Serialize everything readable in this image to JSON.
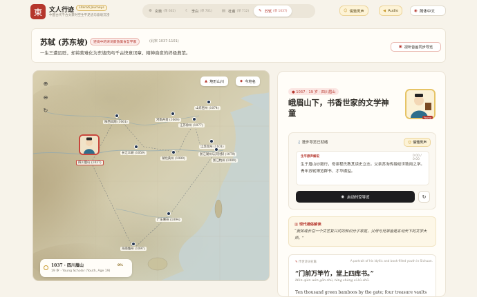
{
  "brand": {
    "logo_char": "東",
    "title": "文人行迹",
    "tag": "Literati Journeys",
    "subtitle": "中国古代千古文豪时空生平足迹与意境沉浸"
  },
  "tabs": [
    {
      "label": "玄奘",
      "count": "(单 602)",
      "icon": "monk-icon",
      "active": false
    },
    {
      "label": "李白",
      "count": "(单 701)",
      "icon": "moon-icon",
      "active": false
    },
    {
      "label": "杜甫",
      "count": "(单 712)",
      "icon": "scroll-icon",
      "active": false
    },
    {
      "label": "苏轼",
      "count": "(单 1037)",
      "icon": "bamboo-icon",
      "active": true
    }
  ],
  "top_buttons": {
    "voice": "儒雅男声",
    "audio": "Audio",
    "language": "简体中文"
  },
  "poet": {
    "name": "苏轼 (苏东坡)",
    "tag": "逆境中的宋词豪放美食哲学家",
    "years": "(北宋 1037-1101)",
    "motto": "一生三遭远贬，却将苦难化为东坡肉与千古快意词章，精神自愈的终极典范。",
    "guide_button": "视听音画同步导览"
  },
  "map": {
    "terrain_button": "地形山川",
    "places_button": "今地名",
    "zoom_in": "+",
    "zoom_out": "−",
    "reset": "↻",
    "places": [
      {
        "label": "陕西凤翔 (1061)"
      },
      {
        "label": "河南开封 (1069)"
      },
      {
        "label": "山东密州 (1074)"
      },
      {
        "label": "江苏徐州 (1077)"
      },
      {
        "label": "长江三峡 (1059)"
      },
      {
        "label": "湖北黄州 (1080)"
      },
      {
        "label": "江苏常州 (1101)"
      },
      {
        "label": "浙江湖州与开封狱 (1079)"
      },
      {
        "label": "浙江杭州 (1089)"
      },
      {
        "label": "四川眉山 (1037)"
      },
      {
        "label": "广东惠州 (1094)"
      },
      {
        "label": "海南儋州 (1097)"
      }
    ],
    "status": {
      "year_place": "1037 · 四川眉山",
      "sub": "19 岁 · Young Scholar (Youth, Age 19)",
      "progress": "0%"
    }
  },
  "panel": {
    "badge": "1037 · 19 岁 · 四川眉山",
    "title": "峨眉山下，书香世家的文学神童",
    "portrait_tag": "Young",
    "audio": {
      "title": "漫步导览已就绪",
      "voice": "儒雅男声",
      "subtitle_label": "生平原声解说",
      "time": "0:00 / 0:00",
      "subtitle_text": "生于眉山纱縠行，母亲程氏教其读史立志。父亲苏洵传授经世致用之学。青年苏轼博览群书、才华横溢。",
      "play_label": "启动时空导览",
      "reset_label": "↻"
    },
    "interp": {
      "title": "现代通俗解读",
      "text": "“我如或长在一个文艺复兴式的知识分子家庭，父母与兄弟皆是名动天下的文学大师。”"
    },
    "poem": {
      "source": "传世诗词名篇",
      "caption": "A portrait of his idyllic and book-filled youth in Sichuan.",
      "line": "“门前万竿竹，堂上四库书。”",
      "pinyin": "Mén qián wàn gān zhú, táng shàng sì kù shū.",
      "english": "Ten thousand green bamboos by the gate; four treasure vaults"
    }
  }
}
